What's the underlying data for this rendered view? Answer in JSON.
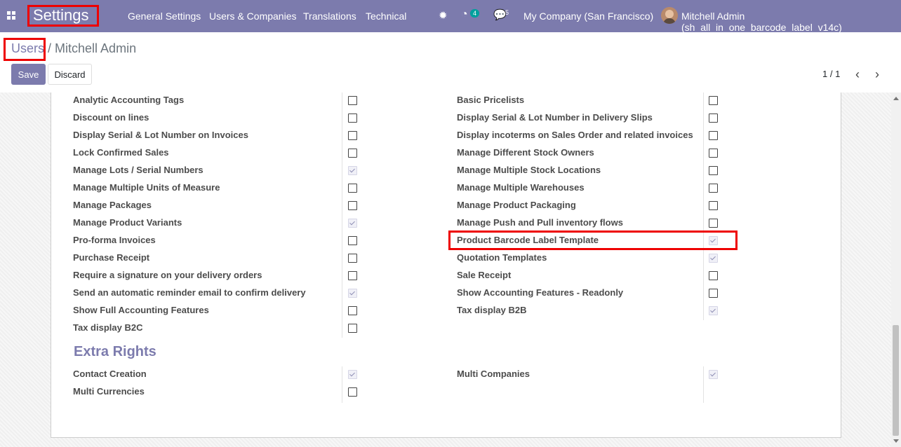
{
  "navbar": {
    "brand": "Settings",
    "menus": [
      "General Settings",
      "Users & Companies",
      "Translations",
      "Technical"
    ],
    "activity_count": "4",
    "message_count": "5",
    "company": "My Company (San Francisco)",
    "user": "Mitchell Admin (sh_all_in_one_barcode_label_v14c)"
  },
  "breadcrumb": {
    "parent": "Users",
    "separator": " / ",
    "current": "Mitchell Admin"
  },
  "buttons": {
    "save": "Save",
    "discard": "Discard"
  },
  "pager": {
    "text": "1 / 1"
  },
  "rights": {
    "left": [
      {
        "label": "Analytic Accounting Tags",
        "checked": false
      },
      {
        "label": "Discount on lines",
        "checked": false
      },
      {
        "label": "Display Serial & Lot Number on Invoices",
        "checked": false
      },
      {
        "label": "Lock Confirmed Sales",
        "checked": false
      },
      {
        "label": "Manage Lots / Serial Numbers",
        "checked": true
      },
      {
        "label": "Manage Multiple Units of Measure",
        "checked": false
      },
      {
        "label": "Manage Packages",
        "checked": false
      },
      {
        "label": "Manage Product Variants",
        "checked": true
      },
      {
        "label": "Pro-forma Invoices",
        "checked": false
      },
      {
        "label": "Purchase Receipt",
        "checked": false
      },
      {
        "label": "Require a signature on your delivery orders",
        "checked": false
      },
      {
        "label": "Send an automatic reminder email to confirm delivery",
        "checked": true
      },
      {
        "label": "Show Full Accounting Features",
        "checked": false
      },
      {
        "label": "Tax display B2C",
        "checked": false
      }
    ],
    "right": [
      {
        "label": "Basic Pricelists",
        "checked": false
      },
      {
        "label": "Display Serial & Lot Number in Delivery Slips",
        "checked": false
      },
      {
        "label": "Display incoterms on Sales Order and related invoices",
        "checked": false
      },
      {
        "label": "Manage Different Stock Owners",
        "checked": false
      },
      {
        "label": "Manage Multiple Stock Locations",
        "checked": false
      },
      {
        "label": "Manage Multiple Warehouses",
        "checked": false
      },
      {
        "label": "Manage Product Packaging",
        "checked": false
      },
      {
        "label": "Manage Push and Pull inventory flows",
        "checked": false
      },
      {
        "label": "Product Barcode Label Template",
        "checked": true
      },
      {
        "label": "Quotation Templates",
        "checked": true
      },
      {
        "label": "Sale Receipt",
        "checked": false
      },
      {
        "label": "Show Accounting Features - Readonly",
        "checked": false
      },
      {
        "label": "Tax display B2B",
        "checked": true
      }
    ]
  },
  "extra_rights": {
    "title": "Extra Rights",
    "left": [
      {
        "label": "Contact Creation",
        "checked": true
      },
      {
        "label": "Multi Currencies",
        "checked": false
      }
    ],
    "right": [
      {
        "label": "Multi Companies",
        "checked": true
      }
    ]
  }
}
